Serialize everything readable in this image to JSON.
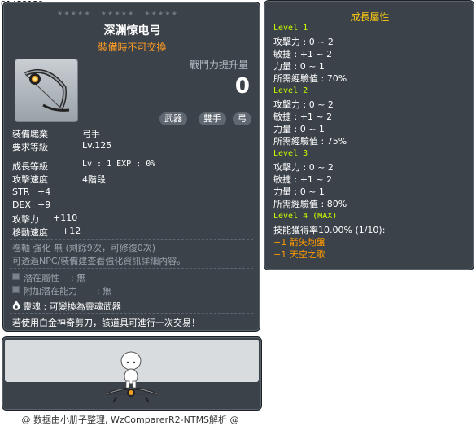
{
  "item_id": "01452129",
  "tooltip": {
    "stars": [
      "★★★★★",
      "★★★★★",
      "★★★★★"
    ],
    "name": "深渊惊电弓",
    "trade_status": "裝備時不可交換",
    "power_label": "戰鬥力提升量",
    "power_value": "0",
    "tags": [
      "武器",
      "雙手",
      "弓"
    ],
    "job_label": "裝備職業",
    "job_value": "弓手",
    "level_label": "要求等級",
    "level_value": "Lv.125",
    "growth_label": "成長等級",
    "growth_value": "Lv : 1   EXP : 0%",
    "speed_label": "攻擊速度",
    "speed_value": "4階段",
    "str_label": "STR",
    "str_value": "+4",
    "dex_label": "DEX",
    "dex_value": "+9",
    "atk_label": "攻擊力",
    "atk_value": "+110",
    "move_label": "移動速度",
    "move_value": "+12",
    "scroll_text": "卷軸 強化 無 (剩餘9次，可修復0次)",
    "npc_text": "可透過NPC/裝備建查看強化資訊詳細內容。",
    "potential_label": "潛在屬性",
    "potential_value": ": 無",
    "add_potential_label": "附加潛在能力",
    "add_potential_value": ": 無",
    "soul_text": "靈魂 : 可變換為靈魂武器",
    "notice_text": "若使用白金神奇剪刀，該道具可進行一次交易！"
  },
  "growth": {
    "title": "成長屬性",
    "levels": [
      {
        "label": "Level 1",
        "lines": [
          "攻擊力 : 0 ~ 2",
          "敏捷 : +1 ~ 2",
          "力量 : 0 ~ 1",
          "所需經驗值 : 70%"
        ]
      },
      {
        "label": "Level 2",
        "lines": [
          "攻擊力 : 0 ~ 2",
          "敏捷 : +1 ~ 2",
          "力量 : 0 ~ 1",
          "所需經驗值 : 75%"
        ]
      },
      {
        "label": "Level 3",
        "lines": [
          "攻擊力 : 0 ~ 2",
          "敏捷 : +1 ~ 2",
          "力量 : 0 ~ 1",
          "所需經驗值 : 80%"
        ]
      },
      {
        "label": "Level 4 (MAX)",
        "lines": [
          "技能獲得率10.00% (1/10):"
        ],
        "skills": [
          "+1 箭矢炮盤",
          "+1 天空之歌"
        ]
      }
    ]
  },
  "footer": "@ 数据由小册子整理, WzComparerR2-NTMS解析 @",
  "icons": {
    "item": "bow-icon",
    "soul": "soul-flame-icon",
    "potential": "square-bullet-icon"
  },
  "colors": {
    "panel_bg": "#3b4249",
    "trade_orange": "#ff9c25",
    "growth_title": "#ffcc11",
    "level_green": "#ccff00",
    "skill_orange": "#ff9900"
  }
}
